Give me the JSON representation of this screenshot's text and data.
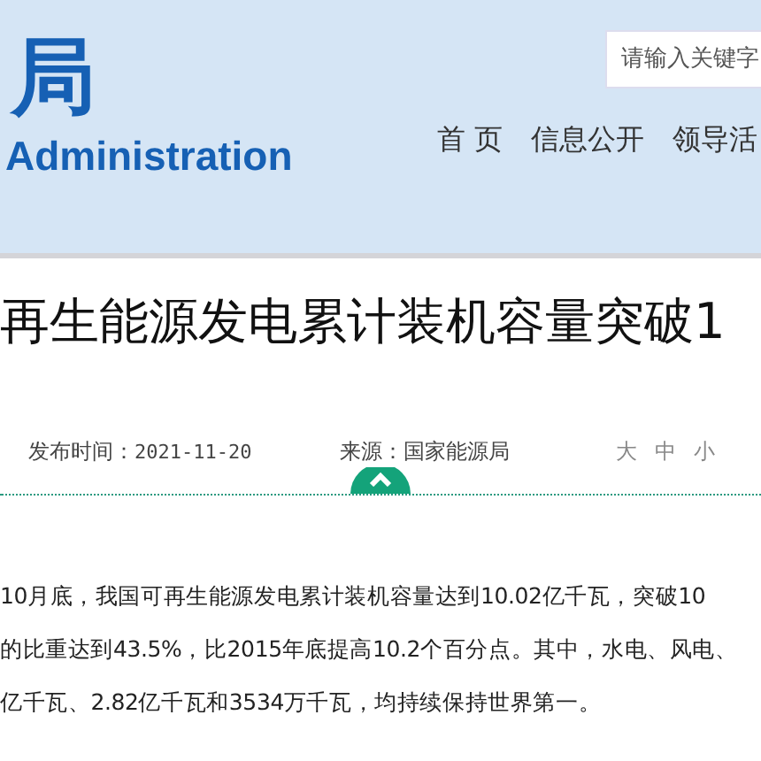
{
  "header": {
    "logo_cn": "局",
    "logo_en": "Administration",
    "search": {
      "placeholder": "请输入关键字"
    },
    "nav": [
      {
        "label": "首 页"
      },
      {
        "label": "信息公开"
      },
      {
        "label": "领导活"
      }
    ]
  },
  "article": {
    "title": "再生能源发电累计装机容量突破1",
    "meta": {
      "date_label": "发布时间：",
      "date": "2021-11-20",
      "source": "来源：国家能源局",
      "font_sizes": [
        "大",
        "中",
        "小"
      ]
    },
    "paragraphs": [
      "10月底，我国可再生能源发电累计装机容量达到10.02亿千瓦，突破10",
      "的比重达到43.5%，比2015年底提高10.2个百分点。其中，水电、风电、",
      "亿千瓦、2.82亿千瓦和3534万千瓦，均持续保持世界第一。"
    ]
  }
}
